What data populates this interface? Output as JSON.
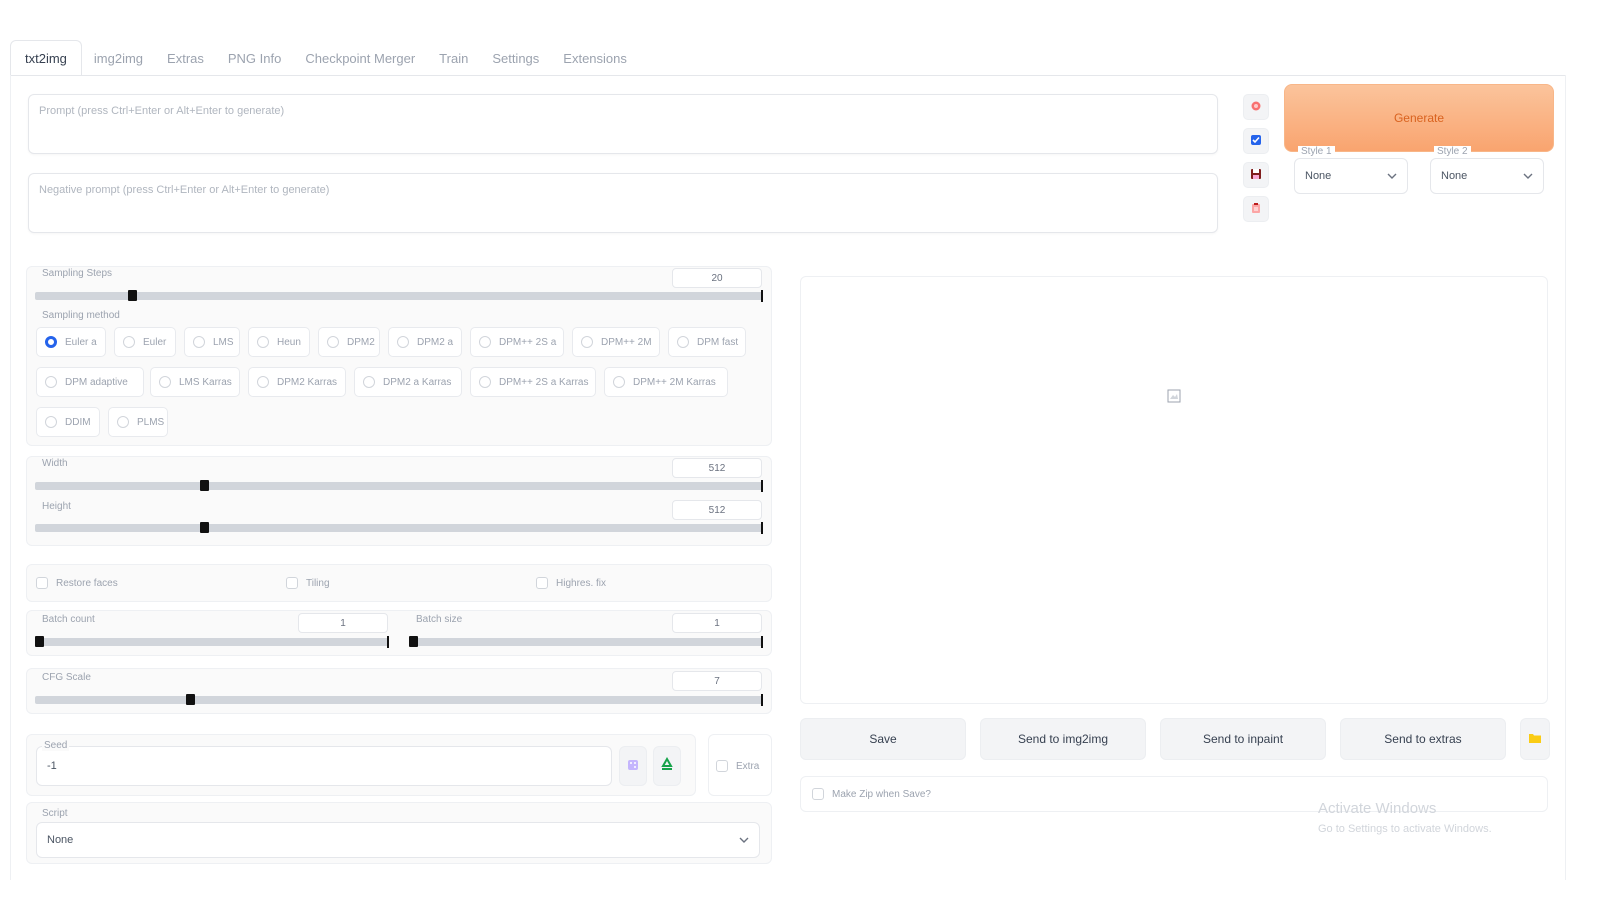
{
  "tabs": [
    {
      "label": "txt2img",
      "active": true
    },
    {
      "label": "img2img"
    },
    {
      "label": "Extras"
    },
    {
      "label": "PNG Info"
    },
    {
      "label": "Checkpoint Merger"
    },
    {
      "label": "Train"
    },
    {
      "label": "Settings"
    },
    {
      "label": "Extensions"
    }
  ],
  "prompt": {
    "placeholder": "Prompt (press Ctrl+Enter or Alt+Enter to generate)",
    "value": ""
  },
  "negative_prompt": {
    "placeholder": "Negative prompt (press Ctrl+Enter or Alt+Enter to generate)",
    "value": ""
  },
  "tool_icons": [
    "paste-icon",
    "checkbox-icon",
    "save-style-icon",
    "clipboard-icon"
  ],
  "generate_label": "Generate",
  "styles": [
    {
      "label": "Style 1",
      "value": "None"
    },
    {
      "label": "Style 2",
      "value": "None"
    }
  ],
  "sampling_steps": {
    "label": "Sampling Steps",
    "value": "20",
    "fraction": 0.13
  },
  "sampling_method": {
    "label": "Sampling method",
    "selected": "Euler a",
    "options": [
      "Euler a",
      "Euler",
      "LMS",
      "Heun",
      "DPM2",
      "DPM2 a",
      "DPM++ 2S a",
      "DPM++ 2M",
      "DPM fast",
      "DPM adaptive",
      "LMS Karras",
      "DPM2 Karras",
      "DPM2 a Karras",
      "DPM++ 2S a Karras",
      "DPM++ 2M Karras",
      "DDIM",
      "PLMS"
    ]
  },
  "width": {
    "label": "Width",
    "value": "512",
    "fraction": 0.23
  },
  "height": {
    "label": "Height",
    "value": "512",
    "fraction": 0.23
  },
  "checks": {
    "restore_faces": "Restore faces",
    "tiling": "Tiling",
    "highres_fix": "Highres. fix"
  },
  "batch_count": {
    "label": "Batch count",
    "value": "1",
    "fraction": 0.0
  },
  "batch_size": {
    "label": "Batch size",
    "value": "1",
    "fraction": 0.0
  },
  "cfg_scale": {
    "label": "CFG Scale",
    "value": "7",
    "fraction": 0.21
  },
  "seed": {
    "label": "Seed",
    "value": "-1",
    "extra_label": "Extra"
  },
  "script": {
    "label": "Script",
    "value": "None"
  },
  "output_buttons": [
    "Save",
    "Send to img2img",
    "Send to inpaint",
    "Send to extras"
  ],
  "zip_label": "Make Zip when Save?",
  "watermark": {
    "title": "Activate Windows",
    "subtitle": "Go to Settings to activate Windows."
  },
  "colors": {
    "accent": "#f9a46f",
    "radio_selected": "#2563eb",
    "recycle": "#16a34a"
  }
}
